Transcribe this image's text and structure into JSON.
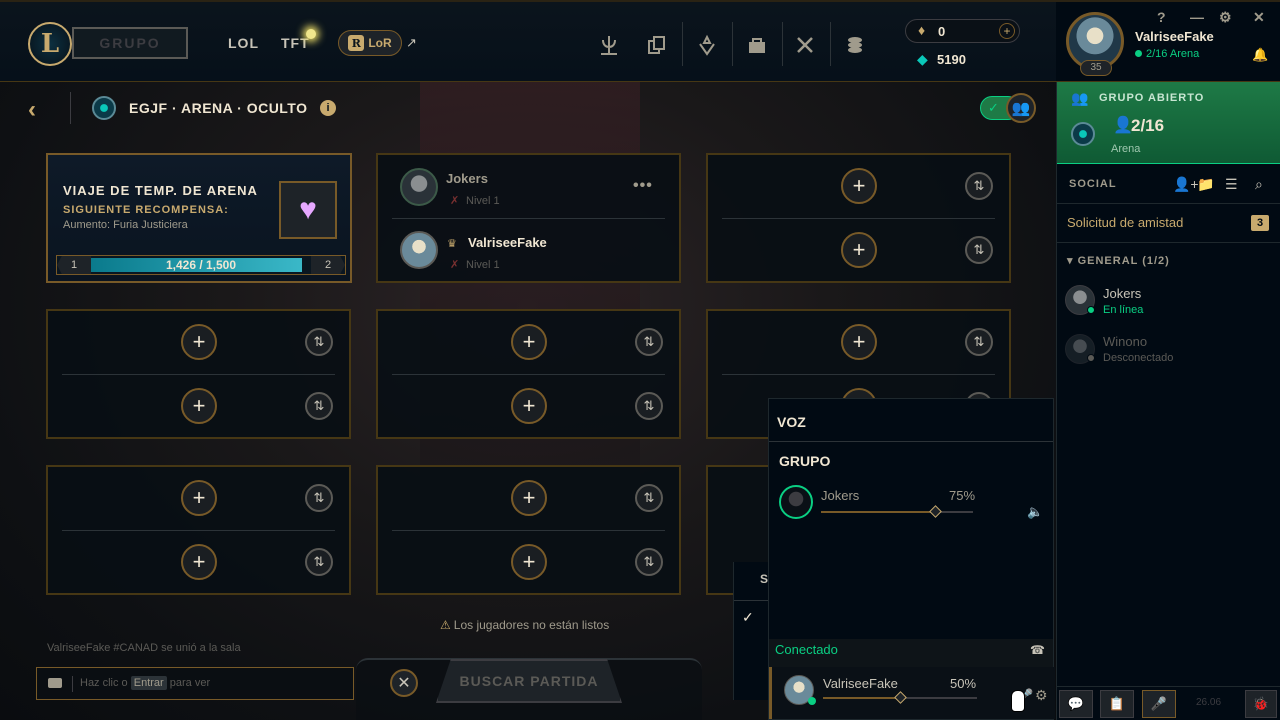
{
  "topbar": {
    "logo_letter": "L",
    "play_label": "GRUPO",
    "nav": [
      "LOL",
      "TFT"
    ],
    "lor_label": "LoR",
    "lor_icon": "R",
    "external_arrow": "↗",
    "icons": [
      "trophy-icon",
      "collection-icon",
      "loot-icon",
      "store-icon",
      "tools-icon",
      "currency-exchange-icon"
    ],
    "rp_value": "0",
    "rp_add": "+",
    "be_value": "5190"
  },
  "profile": {
    "name": "ValriseeFake",
    "status": "2/16 Arena",
    "level": "35",
    "help": "?",
    "minimize": "—",
    "settings": "⚙",
    "close": "✕"
  },
  "lobby": {
    "back": "‹",
    "title": "EGJF · ARENA · OCULTO",
    "info": "i"
  },
  "passport": {
    "title": "VIAJE DE TEMP. DE ARENA",
    "subtitle": "SIGUIENTE RECOMPENSA:",
    "reward": "Aumento: Furia Justiciera",
    "level_from": "1",
    "level_to": "2",
    "progress_text": "1,426 / 1,500",
    "progress_fraction": 0.951
  },
  "members": [
    {
      "name": "Jokers",
      "level": "Nivel 1",
      "color": "#a09b8c"
    },
    {
      "name": "ValriseeFake",
      "level": "Nivel 1",
      "color": "#f0e6d2"
    }
  ],
  "slot_symbols": {
    "add": "+",
    "swap": "⇅"
  },
  "chat": {
    "last_message": "ValriseeFake #CANAD se unió a la sala",
    "placeholder_a": "Haz clic o",
    "placeholder_key": "Entrar",
    "placeholder_b": "para ver"
  },
  "footer": {
    "not_ready": "Los jugadores no están listos",
    "warn": "⚠",
    "cancel": "✕",
    "find_match": "BUSCAR PARTIDA"
  },
  "partial_panel": {
    "letter": "S",
    "check": "✓"
  },
  "voice": {
    "title": "VOZ",
    "group_label": "GRUPO",
    "participants": [
      {
        "name": "Jokers",
        "volume_label": "75%",
        "volume": 0.75
      }
    ],
    "connected_label": "Conectado",
    "me": {
      "name": "ValriseeFake",
      "volume_label": "50%",
      "volume": 0.5
    },
    "speaker": "🔈",
    "disconnect": "☎",
    "gear": "⚙"
  },
  "social": {
    "lobby_card": {
      "title": "GRUPO ABIERTO",
      "count": "2/16",
      "mode": "Arena"
    },
    "header": "SOCIAL",
    "friend_requests": "Solicitud de amistad",
    "friend_requests_count": "3",
    "group_header": "GENERAL (1/2)",
    "friends": [
      {
        "name": "Jokers",
        "status": "En línea",
        "status_color": "#0acf83",
        "name_color": "#c8c4b8"
      },
      {
        "name": "Winono",
        "status": "Desconectado",
        "status_color": "#5b5a56",
        "name_color": "#5b5a56"
      }
    ],
    "version": "26.06"
  }
}
